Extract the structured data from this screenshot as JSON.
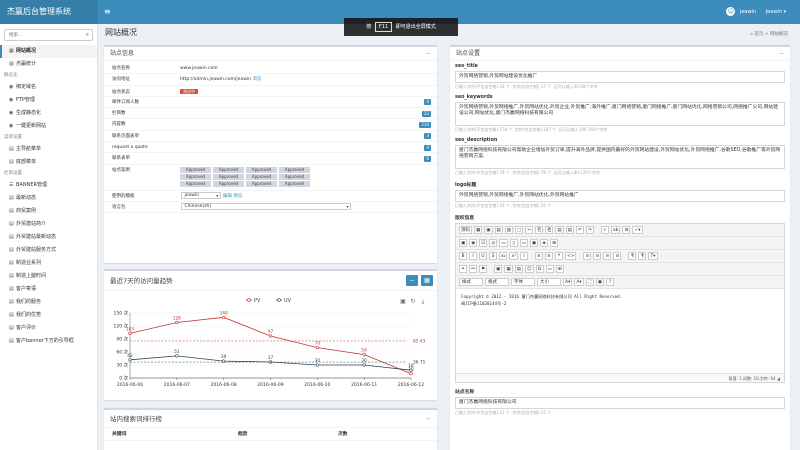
{
  "app": {
    "title": "杰赢后台管理系统",
    "menu_toggle": "≡",
    "user": "jeawin",
    "user_menu": "jeawin ▾",
    "user_icon_glyph": "☺"
  },
  "fullscreen_hint": {
    "pre": "按",
    "key": "F11",
    "post": "即可退出全屏模式"
  },
  "sidebar": {
    "search_placeholder": "搜索...",
    "items": [
      {
        "label": "网站概况",
        "icon": "▦",
        "active": true
      },
      {
        "label": "杰赢统计",
        "icon": "▨"
      },
      {
        "group": "静态化"
      },
      {
        "label": "绑定域名",
        "icon": "◉"
      },
      {
        "label": "FTP管理",
        "icon": "◉"
      },
      {
        "label": "生成静态化",
        "icon": "◉"
      },
      {
        "label": "一键更新网站",
        "icon": "◉"
      },
      {
        "group": "菜单设置"
      },
      {
        "label": "主导航菜单",
        "icon": "▤"
      },
      {
        "label": "底部菜单",
        "icon": "▤"
      },
      {
        "group": "栏目设置"
      },
      {
        "label": "BANNER管理",
        "icon": "☰"
      },
      {
        "label": "最新动态",
        "icon": "▤"
      },
      {
        "label": "商贸案例",
        "icon": "▤"
      },
      {
        "label": "外贸建站简介",
        "icon": "▤"
      },
      {
        "label": "外贸建站最新动态",
        "icon": "▤"
      },
      {
        "label": "外贸建站服务方式",
        "icon": "▤"
      },
      {
        "label": "制造业系列",
        "icon": "▤"
      },
      {
        "label": "制造上腿时间",
        "icon": "▤"
      },
      {
        "label": "客户寄语",
        "icon": "▤"
      },
      {
        "label": "我们的服务",
        "icon": "▤"
      },
      {
        "label": "我们的优势",
        "icon": "▤"
      },
      {
        "label": "客户评价",
        "icon": "▤"
      },
      {
        "label": "客户banner下方的引导框",
        "icon": "▤"
      }
    ]
  },
  "header": {
    "title": "网站概况",
    "breadcrumb_home": "首页",
    "breadcrumb_sep": ">",
    "breadcrumb_current": "网站概况",
    "home_icon": "⌂"
  },
  "site_info": {
    "title": "站点信息",
    "collapse": "−",
    "rows": [
      {
        "label": "站点名称",
        "value": "www.jeawin.com"
      },
      {
        "label": "访问地址",
        "value": "http://admin.jeawin.com/jeawin",
        "link": "浏览"
      },
      {
        "label": "站点状态",
        "badge": "测试中"
      },
      {
        "label": "邮件订阅人数",
        "count": "0"
      },
      {
        "label": "栏目数",
        "count": "22"
      },
      {
        "label": "内容数",
        "count": "210"
      },
      {
        "label": "联系页面表单",
        "count": "3"
      },
      {
        "label": "request a quote",
        "count": "0"
      },
      {
        "label": "联系表单",
        "count": "6"
      }
    ],
    "examples_label": "站点案例",
    "approved": [
      "Approved",
      "Approved",
      "Approved",
      "Approved",
      "Approved",
      "Approved",
      "Approved",
      "Approved",
      "Approved",
      "Approved",
      "Approved",
      "Approved"
    ],
    "template_label": "使用的模板",
    "template_value": "jeawin",
    "template_edit": "编辑",
    "template_preview": "预览",
    "language_label": "语言包",
    "language_value": "Chinese(zh)"
  },
  "chart_panel": {
    "title": "最近7天的访问量趋势",
    "btn_left": "−",
    "btn_right": "▦",
    "tool_icons": [
      "▣",
      "↻",
      "⤓"
    ]
  },
  "chart_data": {
    "type": "line",
    "categories": [
      "2016-06-06",
      "2016-06-07",
      "2016-06-08",
      "2016-06-09",
      "2016-06-10",
      "2016-06-11",
      "2016-06-12"
    ],
    "series": [
      {
        "name": "PV",
        "values": [
          103,
          128,
          140,
          97,
          70,
          54,
          10
        ],
        "color": "#c23531",
        "avg": "85.43"
      },
      {
        "name": "UV",
        "values": [
          42,
          51,
          39,
          37,
          30,
          30,
          18
        ],
        "color": "#2f4554",
        "avg": "36.71"
      }
    ],
    "ylim": [
      0,
      150
    ],
    "yticks": [
      0,
      30,
      60,
      90,
      120,
      150
    ],
    "yunit": "次",
    "legend_position": "top-center"
  },
  "search_rank": {
    "title": "站内搜索词排行榜",
    "collapse": "−",
    "columns": [
      "关键词",
      "趋势",
      "次数"
    ]
  },
  "site_settings": {
    "title": "站点设置",
    "collapse": "−",
    "seo_title_label": "seo_title",
    "seo_title_value": "外贸网络营销,外贸网站建设优化推广",
    "seo_title_help": "已输入字符(不包含空格):18 个 ,字符(包含空格):17 个 ,还可以输入50-58个字符",
    "seo_keywords_label": "seo_keywords",
    "seo_keywords_value": "外贸网络营销,外贸网络推广,外贸网站优化,外贸企业,外贸推广,海外推广,厦门网络营销,厦门网络推广,厦门网站优化,网络营销公司,网络推广公司,网站建设公司,网站优化,厦门杰赢网络科技有限公司",
    "seo_keywords_help": "已输入字符(不包含空格):178 个 ,字符(包含空格):197 个 ,还可以输入100-160个字符",
    "seo_description_label": "seo_description",
    "seo_description_value": "厦门杰赢网络科技有限公司帮助企业增加外贸订单,提升海外品牌,提供国内最好的外贸网站建设,外贸网站优化,外贸网络推广,谷歌SEO,谷歌推广等外贸网络营销方案.",
    "seo_description_help": "已输入字符(不包含空格):78 个 ,字符(包含空格):78 个 ,还可以输入80-120个字符",
    "logo_label": "logo标题",
    "logo_value": "外贸网络营销,外贸网络推广,外贸网站优化,外贸网站推广",
    "logo_help": "已输入字符(不包含空格):26 个 ,字符(包含空格):26 个",
    "copyright_label": "版权信息",
    "toolbar1": [
      "源码",
      "▦",
      "▣",
      "▤",
      "▥",
      "▢",
      "✂",
      "⎘",
      "⎗",
      "▤",
      "▤",
      "↶",
      "↷",
      "",
      "⌕",
      "ab",
      "⊟",
      "✓▾"
    ],
    "toolbar2": [
      "▣",
      "◉",
      "☑",
      "◎",
      "▭",
      "▯",
      "▭",
      "▣",
      "◈",
      "⊞"
    ],
    "toolbar3": [
      "B",
      "I",
      "U",
      "S",
      "x₂",
      "x²",
      "I",
      "",
      "≡",
      "≡",
      "❝",
      "<>",
      "",
      "≡",
      "≡",
      "≡",
      "≡",
      "",
      "¶",
      "¶",
      "T▾"
    ],
    "toolbar4": [
      "⚭",
      "⚯",
      "⚑",
      "",
      "▣",
      "▦",
      "▤",
      "☺",
      "Ω",
      "▭",
      "⊞"
    ],
    "toolbar5": [
      "样式",
      "格式",
      "字体",
      "大小",
      "A▾",
      "A▾",
      "⛶",
      "▣",
      "?"
    ],
    "editor_text": "Copyright ©   2012 - 2016 厦门杰赢网络科技有限公司 All Right Reserved.\n闽ICP备11020144号-2",
    "editor_status": "段落: 1,词数: 10,字符: 64 ◢",
    "site_name_label": "站点名称",
    "site_name_value": "厦门杰赢网络科技有限公司",
    "site_name_help": "已输入字符(不包含空格):12 个 ,字符(包含空格):12 个"
  }
}
